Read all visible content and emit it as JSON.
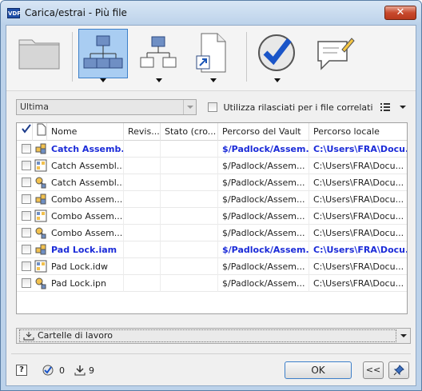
{
  "window": {
    "title": "Carica/estrai - Più file",
    "app_badge": "VDF",
    "close_glyph": "✕"
  },
  "toolbar": {
    "buttons": [
      {
        "icon": "folder-icon"
      },
      {
        "icon": "network-hierarchy-icon",
        "active": true,
        "has_dropdown": true
      },
      {
        "icon": "hierarchy-icon",
        "has_dropdown": true
      },
      {
        "icon": "shortcut-document-icon",
        "has_dropdown": true
      },
      {
        "icon": "checkmark-icon",
        "has_dropdown": true
      },
      {
        "icon": "comment-icon"
      }
    ]
  },
  "options": {
    "version_select": "Ultima",
    "use_released_label": "Utilizza rilasciati per i file correlati",
    "use_released_checked": false
  },
  "grid": {
    "columns": [
      "Nome",
      "Revis...",
      "Stato (cro...",
      "Percorso del Vault",
      "Percorso locale"
    ],
    "rows": [
      {
        "name": "Catch Assemb...",
        "revision": "",
        "state": "",
        "vault_path": "$/Padlock/Assem...",
        "local_path": "C:\\Users\\FRA\\Docu...",
        "bold": true,
        "icon": "assembly-icon"
      },
      {
        "name": "Catch Assembl...",
        "revision": "",
        "state": "",
        "vault_path": "$/Padlock/Assem...",
        "local_path": "C:\\Users\\FRA\\Docu...",
        "bold": false,
        "icon": "drawing-icon"
      },
      {
        "name": "Catch Assembl...",
        "revision": "",
        "state": "",
        "vault_path": "$/Padlock/Assem...",
        "local_path": "C:\\Users\\FRA\\Docu...",
        "bold": false,
        "icon": "presentation-icon"
      },
      {
        "name": "Combo Assem...",
        "revision": "",
        "state": "",
        "vault_path": "$/Padlock/Assem...",
        "local_path": "C:\\Users\\FRA\\Docu...",
        "bold": false,
        "icon": "assembly-icon"
      },
      {
        "name": "Combo Assem...",
        "revision": "",
        "state": "",
        "vault_path": "$/Padlock/Assem...",
        "local_path": "C:\\Users\\FRA\\Docu...",
        "bold": false,
        "icon": "drawing-icon"
      },
      {
        "name": "Combo Assem...",
        "revision": "",
        "state": "",
        "vault_path": "$/Padlock/Assem...",
        "local_path": "C:\\Users\\FRA\\Docu...",
        "bold": false,
        "icon": "presentation-icon"
      },
      {
        "name": "Pad Lock.iam",
        "revision": "",
        "state": "",
        "vault_path": "$/Padlock/Assem...",
        "local_path": "C:\\Users\\FRA\\Docu...",
        "bold": true,
        "icon": "assembly-icon"
      },
      {
        "name": "Pad Lock.idw",
        "revision": "",
        "state": "",
        "vault_path": "$/Padlock/Assem...",
        "local_path": "C:\\Users\\FRA\\Docu...",
        "bold": false,
        "icon": "drawing-icon"
      },
      {
        "name": "Pad Lock.ipn",
        "revision": "",
        "state": "",
        "vault_path": "$/Padlock/Assem...",
        "local_path": "C:\\Users\\FRA\\Docu...",
        "bold": false,
        "icon": "presentation-icon"
      }
    ]
  },
  "folders": {
    "label": "Cartelle di lavoro",
    "icon": "download-folder-icon"
  },
  "footer": {
    "help": "?",
    "checked_count": "0",
    "download_count": "9",
    "ok_label": "OK",
    "collapse_label": "<<",
    "pin_icon": "pin-icon"
  },
  "colors": {
    "accent": "#3c7fc9",
    "title_bar": "#bcd2ea",
    "bold_row_text": "#1b2bd8"
  }
}
